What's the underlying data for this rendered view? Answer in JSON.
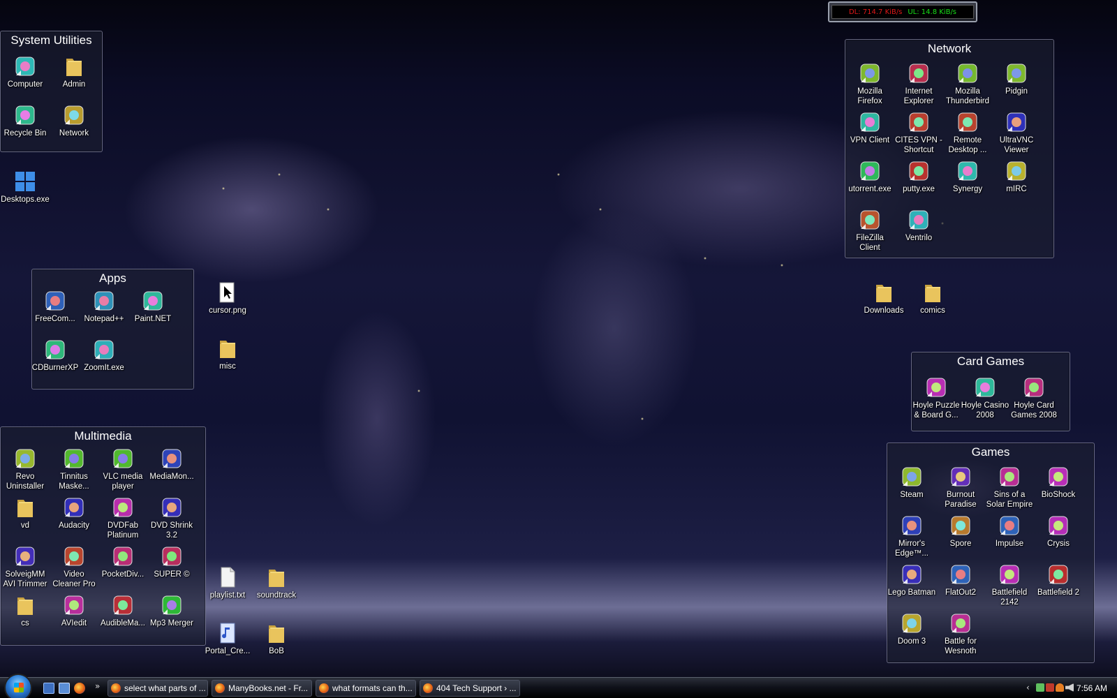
{
  "netmeter": {
    "dl": "DL: 714.7 KiB/s",
    "ul": "UL: 14.8 KiB/s"
  },
  "fences": {
    "system_utilities": {
      "title": "System Utilities",
      "icons": [
        {
          "label": "Computer",
          "icon": "computer-icon"
        },
        {
          "label": "Admin",
          "icon": "folder-icon"
        },
        {
          "label": "Recycle Bin",
          "icon": "recycle-bin-icon"
        },
        {
          "label": "Network",
          "icon": "network-icon"
        }
      ]
    },
    "apps": {
      "title": "Apps",
      "icons": [
        {
          "label": "FreeCom...",
          "icon": "freecommander-icon"
        },
        {
          "label": "Notepad++",
          "icon": "notepad-icon"
        },
        {
          "label": "Paint.NET",
          "icon": "paintnet-icon"
        },
        {
          "label": "CDBurnerXP",
          "icon": "cdburner-icon"
        },
        {
          "label": "ZoomIt.exe",
          "icon": "zoomit-icon"
        }
      ]
    },
    "multimedia": {
      "title": "Multimedia",
      "icons": [
        {
          "label": "Revo Uninstaller",
          "icon": "revo-icon"
        },
        {
          "label": "Tinnitus Maske...",
          "icon": "tinnitus-icon"
        },
        {
          "label": "VLC media player",
          "icon": "vlc-icon"
        },
        {
          "label": "MediaMon...",
          "icon": "mediamonkey-icon"
        },
        {
          "label": "vd",
          "icon": "folder-icon"
        },
        {
          "label": "Audacity",
          "icon": "audacity-icon"
        },
        {
          "label": "DVDFab Platinum",
          "icon": "dvdfab-icon"
        },
        {
          "label": "DVD Shrink 3.2",
          "icon": "dvdshrink-icon"
        },
        {
          "label": "SolveigMM AVI Trimmer",
          "icon": "solveigmm-icon"
        },
        {
          "label": "Video Cleaner Pro",
          "icon": "video-cleaner-icon"
        },
        {
          "label": "PocketDiv...",
          "icon": "pocketdivx-icon"
        },
        {
          "label": "SUPER ©",
          "icon": "super-icon"
        },
        {
          "label": "cs",
          "icon": "folder-icon"
        },
        {
          "label": "AVIedit",
          "icon": "aviedit-icon"
        },
        {
          "label": "AudibleMa...",
          "icon": "audible-icon"
        },
        {
          "label": "Mp3 Merger",
          "icon": "mp3merger-icon"
        }
      ]
    },
    "network": {
      "title": "Network",
      "icons": [
        {
          "label": "Mozilla Firefox",
          "icon": "firefox-icon"
        },
        {
          "label": "Internet Explorer",
          "icon": "ie-icon"
        },
        {
          "label": "Mozilla Thunderbird",
          "icon": "thunderbird-icon"
        },
        {
          "label": "Pidgin",
          "icon": "pidgin-icon"
        },
        {
          "label": "VPN Client",
          "icon": "vpn-lock-icon"
        },
        {
          "label": "CITES VPN - Shortcut",
          "icon": "vpn-shortcut-icon"
        },
        {
          "label": "Remote Desktop ...",
          "icon": "remote-desktop-icon"
        },
        {
          "label": "UltraVNC Viewer",
          "icon": "ultravnc-icon"
        },
        {
          "label": "utorrent.exe",
          "icon": "utorrent-icon"
        },
        {
          "label": "putty.exe",
          "icon": "putty-icon"
        },
        {
          "label": "Synergy",
          "icon": "synergy-icon"
        },
        {
          "label": "mIRC",
          "icon": "mirc-icon"
        },
        {
          "label": "FileZilla Client",
          "icon": "filezilla-icon"
        },
        {
          "label": "Ventrilo",
          "icon": "ventrilo-icon"
        }
      ]
    },
    "card_games": {
      "title": "Card Games",
      "icons": [
        {
          "label": "Hoyle Puzzle & Board G...",
          "icon": "hoyle-puzzle-icon"
        },
        {
          "label": "Hoyle Casino 2008",
          "icon": "hoyle-casino-icon"
        },
        {
          "label": "Hoyle Card Games 2008",
          "icon": "hoyle-cards-icon"
        }
      ]
    },
    "games": {
      "title": "Games",
      "icons": [
        {
          "label": "Steam",
          "icon": "steam-icon"
        },
        {
          "label": "Burnout Paradise",
          "icon": "burnout-icon"
        },
        {
          "label": "Sins of a Solar Empire",
          "icon": "sins-icon"
        },
        {
          "label": "BioShock",
          "icon": "bioshock-icon"
        },
        {
          "label": "Mirror's Edge™...",
          "icon": "mirrors-edge-icon"
        },
        {
          "label": "Spore",
          "icon": "spore-icon"
        },
        {
          "label": "Impulse",
          "icon": "impulse-icon"
        },
        {
          "label": "Crysis",
          "icon": "crysis-icon"
        },
        {
          "label": "Lego Batman",
          "icon": "lego-batman-icon"
        },
        {
          "label": "FlatOut2",
          "icon": "flatout-icon"
        },
        {
          "label": "Battlefield 2142",
          "icon": "bf2142-icon"
        },
        {
          "label": "Battlefield 2",
          "icon": "bf2-icon"
        },
        {
          "label": "Doom 3",
          "icon": "doom3-icon"
        },
        {
          "label": "Battle for Wesnoth",
          "icon": "wesnoth-icon"
        }
      ]
    }
  },
  "loose_icons": [
    {
      "label": "Desktops.exe",
      "icon": "desktops-icon"
    },
    {
      "label": "cursor.png",
      "icon": "image-file-icon"
    },
    {
      "label": "misc",
      "icon": "folder-icon"
    },
    {
      "label": "Downloads",
      "icon": "folder-icon"
    },
    {
      "label": "comics",
      "icon": "folder-icon"
    },
    {
      "label": "playlist.txt",
      "icon": "text-file-icon"
    },
    {
      "label": "soundtrack",
      "icon": "folder-icon"
    },
    {
      "label": "Portal_Cre...",
      "icon": "audio-file-icon"
    },
    {
      "label": "BoB",
      "icon": "folder-icon"
    }
  ],
  "taskbar": {
    "tasks": [
      {
        "label": "select what parts of ..."
      },
      {
        "label": "ManyBooks.net - Fr..."
      },
      {
        "label": "what formats can th..."
      },
      {
        "label": "404 Tech Support › ..."
      }
    ],
    "clock": "7:56 AM",
    "overflow_glyph": "»",
    "tray_expand_glyph": "‹"
  },
  "colors": {
    "folder": "#e8c25a",
    "fence_bg": "#1c1e30",
    "dl": "#e01818",
    "ul": "#18e018"
  }
}
